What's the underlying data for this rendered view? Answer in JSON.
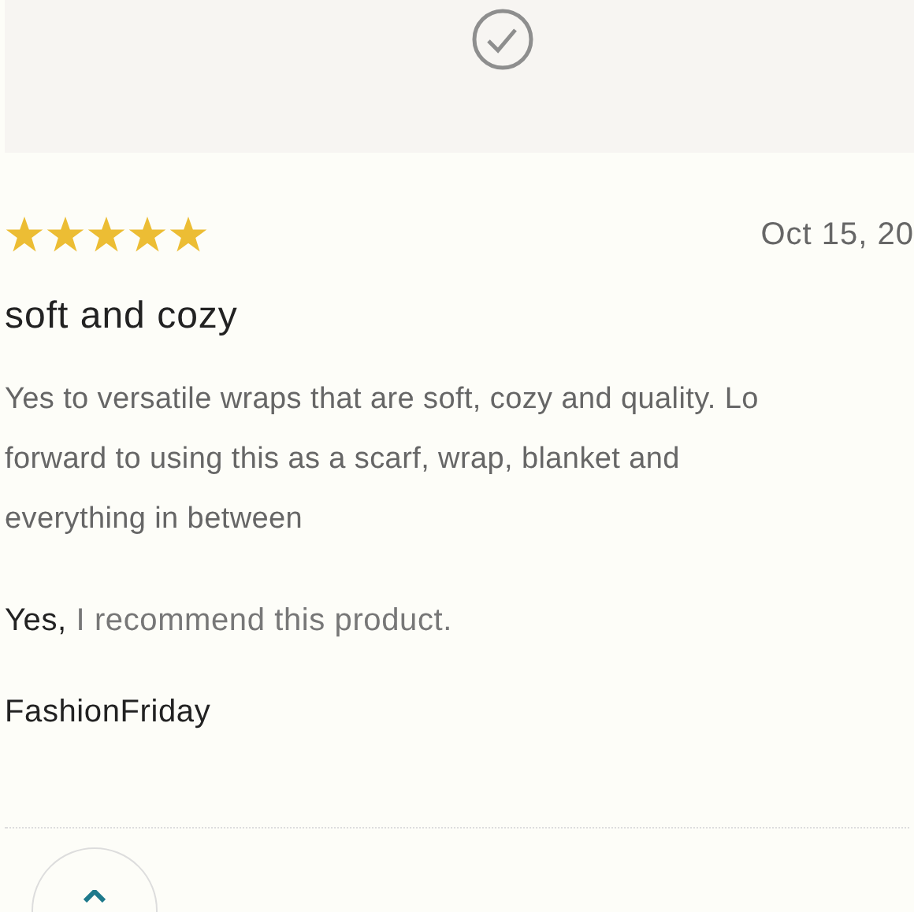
{
  "review": {
    "stars": 5,
    "date": "Oct 15, 20",
    "title": "soft and cozy",
    "body_lines": [
      "Yes to versatile wraps that are soft, cozy and quality. Lo",
      "forward to using this as a scarf, wrap, blanket and",
      "everything in between"
    ],
    "recommend": {
      "answer": "Yes,",
      "text": "I recommend this product."
    },
    "author": "FashionFriday"
  }
}
